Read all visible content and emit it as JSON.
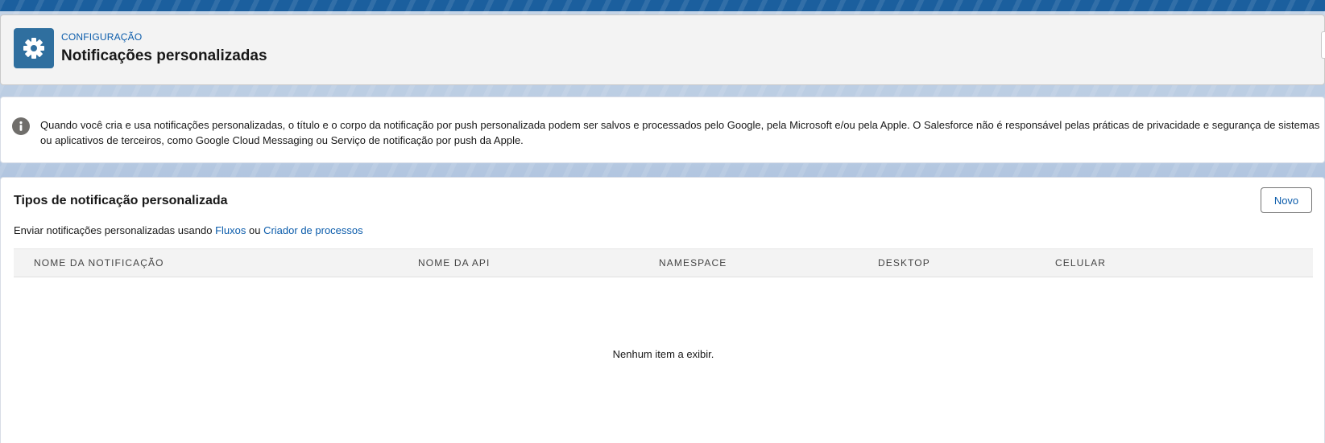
{
  "header": {
    "eyebrow": "CONFIGURAÇÃO",
    "title": "Notificações personalizadas",
    "icon": "gear-icon"
  },
  "info_banner": {
    "icon": "info-icon",
    "text": "Quando você cria e usa notificações personalizadas, o título e o corpo da notificação por push personalizada podem ser salvos e processados pelo Google, pela Microsoft e/ou pela Apple. O Salesforce não é responsável pelas práticas de privacidade e segurança de sistemas ou aplicativos de terceiros, como Google Cloud Messaging ou Serviço de notificação por push da Apple."
  },
  "card": {
    "title": "Tipos de notificação personalizada",
    "new_button": "Novo",
    "description": {
      "prefix": "Enviar notificações personalizadas usando",
      "link_flows": "Fluxos",
      "joiner": "ou",
      "link_process_builder": "Criador de processos"
    },
    "table": {
      "columns": [
        "NOME DA NOTIFICAÇÃO",
        "NOME DA API",
        "NAMESPACE",
        "DESKTOP",
        "CELULAR"
      ],
      "rows": [],
      "empty_message": "Nenhum item a exibir."
    }
  },
  "colors": {
    "brand_header": "#1b5f9e",
    "icon_background": "#2f6f9f",
    "link": "#0b5cab",
    "page_background": "#b0c4df"
  }
}
